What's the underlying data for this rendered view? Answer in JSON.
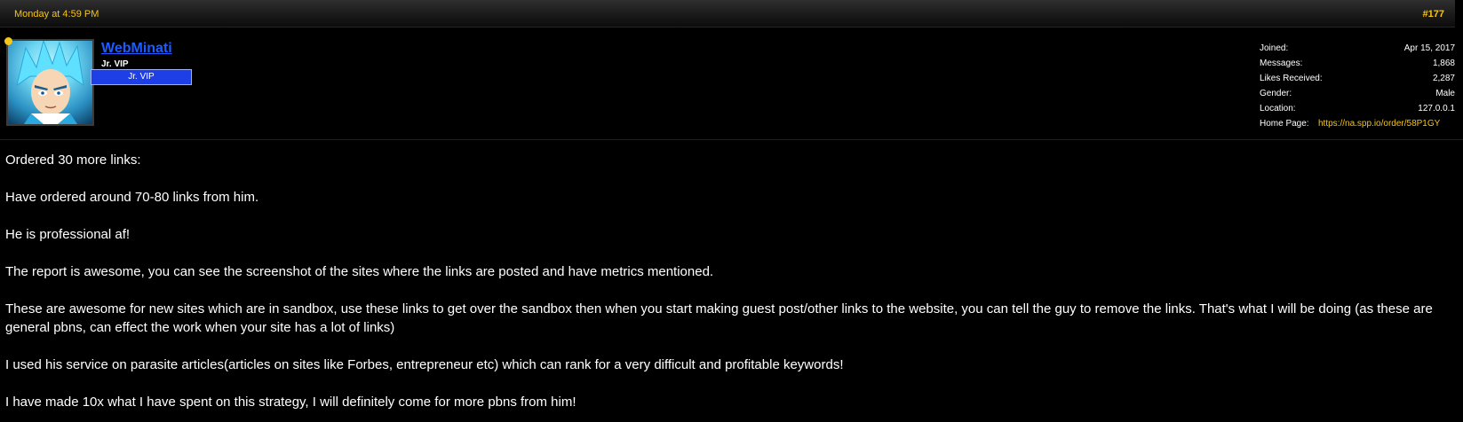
{
  "header": {
    "date": "Monday at 4:59 PM",
    "post_number": "#177"
  },
  "user": {
    "name": "WebMinati",
    "title": "Jr. VIP",
    "banner": "Jr. VIP",
    "avatar_icon": "anime-character-avatar"
  },
  "stats": [
    {
      "label": "Joined:",
      "value": "Apr 15, 2017"
    },
    {
      "label": "Messages:",
      "value": "1,868"
    },
    {
      "label": "Likes Received:",
      "value": "2,287"
    },
    {
      "label": "Gender:",
      "value": "Male"
    },
    {
      "label": "Location:",
      "value": "127.0.0.1"
    },
    {
      "label": "Home Page:",
      "value": "https://na.spp.io/order/58P1GY"
    }
  ],
  "message": {
    "paragraphs": [
      "Ordered 30 more links:",
      "Have ordered around 70-80 links from him.",
      "He is professional af!",
      "The report is awesome, you can see the screenshot of the sites where the links are posted and have metrics mentioned.",
      "These are awesome for new sites which are in sandbox, use these links to get over the sandbox then when you start making guest post/other links to the website, you can tell the guy to remove the links. That's what I will be doing (as these are general pbns, can effect the work when your site has a lot of links)",
      "I used his service on parasite articles(articles on sites like Forbes, entrepreneur etc) which can rank for a very difficult and profitable keywords!",
      "I have made 10x what I have spent on this strategy, I will definitely come for more pbns from him!"
    ]
  },
  "colors": {
    "accent": "#f5c518",
    "username": "#1e5cff",
    "banner": "#1e3fe6",
    "background": "#000000"
  }
}
